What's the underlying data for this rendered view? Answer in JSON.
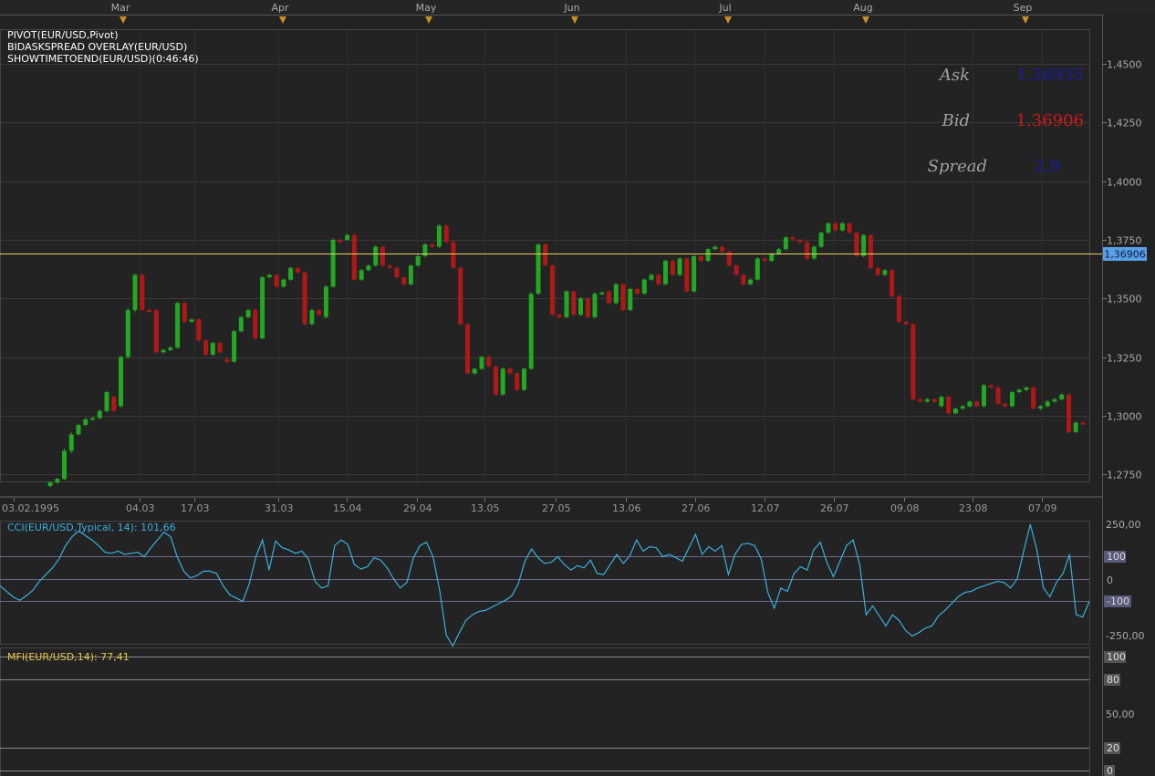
{
  "top_months": {
    "labels": [
      "Mar",
      "Apr",
      "May",
      "Jun",
      "Jul",
      "Aug",
      "Sep"
    ],
    "marker_color": "#c8902a"
  },
  "indicators": {
    "line1": "PIVOT(EUR/USD,Pivot)",
    "line2": "BIDASKSPREAD OVERLAY(EUR/USD)",
    "line3": "SHOWTIMETOEND(EUR/USD)(0:46:46)"
  },
  "quote": {
    "ask_label": "Ask",
    "ask_value": "1.36935",
    "bid_label": "Bid",
    "bid_value": "1.36906",
    "spread_label": "Spread",
    "spread_value": "2.9",
    "ask_color": "#1a1aa0",
    "bid_color": "#d01818",
    "label_color": "#a0a0a0"
  },
  "price_axis": {
    "ticks": [
      "1,4500",
      "1,4250",
      "1,4000",
      "1,3750",
      "1,3500",
      "1,3250",
      "1,3000",
      "1,2750"
    ],
    "current_label": "1,36906",
    "current_label_bg": "#5aa0e6"
  },
  "date_axis": {
    "labels": [
      "03.02.1995",
      "04.03",
      "17.03",
      "31.03",
      "15.04",
      "29.04",
      "13.05",
      "27.05",
      "13.06",
      "27.06",
      "12.07",
      "26.07",
      "09.08",
      "23.08",
      "07.09"
    ]
  },
  "cci": {
    "legend": "CCI(EUR/USD,Typical, 14): 101,66",
    "legend_color": "#3ab0e0",
    "axis_labels": {
      "top": "250,00",
      "p100": "100",
      "zero": "0",
      "m100": "-100",
      "bottom": "-250,00"
    }
  },
  "mfi": {
    "legend": "MFI(EUR/USD,14): 77,41",
    "legend_color": "#e8c848",
    "axis_labels": {
      "l100": "100",
      "l80": "80",
      "l50": "50,00",
      "l20": "20",
      "l0": "0"
    }
  },
  "colors": {
    "up": "#22a822",
    "down": "#b01818",
    "grid": "#3a3a3a",
    "pivot_line": "#e8d060",
    "cci_line": "#3ab0e0"
  },
  "chart_data": {
    "type": "candlestick",
    "title": "",
    "instrument": "EUR/USD",
    "pivot_level": 1.36906,
    "ylim": [
      1.2725,
      1.462
    ],
    "candles": [
      {
        "o": 1.27,
        "c": 1.2715,
        "h": 1.272,
        "l": 1.2695
      },
      {
        "o": 1.2715,
        "c": 1.273,
        "h": 1.2735,
        "l": 1.271
      },
      {
        "o": 1.273,
        "c": 1.285,
        "h": 1.286,
        "l": 1.2725
      },
      {
        "o": 1.285,
        "c": 1.292,
        "h": 1.293,
        "l": 1.284
      },
      {
        "o": 1.292,
        "c": 1.296,
        "h": 1.2965,
        "l": 1.2915
      },
      {
        "o": 1.296,
        "c": 1.2985,
        "h": 1.299,
        "l": 1.2955
      },
      {
        "o": 1.2985,
        "c": 1.299,
        "h": 1.2995,
        "l": 1.298
      },
      {
        "o": 1.299,
        "c": 1.302,
        "h": 1.3025,
        "l": 1.2985
      },
      {
        "o": 1.302,
        "c": 1.31,
        "h": 1.3105,
        "l": 1.3015
      },
      {
        "o": 1.308,
        "c": 1.302,
        "h": 1.3085,
        "l": 1.3015
      },
      {
        "o": 1.304,
        "c": 1.325,
        "h": 1.3255,
        "l": 1.3035
      },
      {
        "o": 1.325,
        "c": 1.345,
        "h": 1.346,
        "l": 1.3245
      },
      {
        "o": 1.345,
        "c": 1.36,
        "h": 1.3605,
        "l": 1.344
      },
      {
        "o": 1.36,
        "c": 1.345,
        "h": 1.3605,
        "l": 1.3445
      },
      {
        "o": 1.345,
        "c": 1.3445,
        "h": 1.3455,
        "l": 1.344
      },
      {
        "o": 1.345,
        "c": 1.327,
        "h": 1.3455,
        "l": 1.3265
      },
      {
        "o": 1.327,
        "c": 1.328,
        "h": 1.3285,
        "l": 1.3265
      },
      {
        "o": 1.328,
        "c": 1.329,
        "h": 1.3295,
        "l": 1.3275
      },
      {
        "o": 1.329,
        "c": 1.348,
        "h": 1.3485,
        "l": 1.3285
      },
      {
        "o": 1.348,
        "c": 1.34,
        "h": 1.3485,
        "l": 1.3395
      },
      {
        "o": 1.34,
        "c": 1.341,
        "h": 1.3415,
        "l": 1.3395
      },
      {
        "o": 1.341,
        "c": 1.332,
        "h": 1.3415,
        "l": 1.3315
      },
      {
        "o": 1.332,
        "c": 1.326,
        "h": 1.3325,
        "l": 1.3255
      },
      {
        "o": 1.326,
        "c": 1.331,
        "h": 1.3315,
        "l": 1.3255
      },
      {
        "o": 1.331,
        "c": 1.327,
        "h": 1.3315,
        "l": 1.3265
      },
      {
        "o": 1.324,
        "c": 1.323,
        "h": 1.325,
        "l": 1.3225
      },
      {
        "o": 1.323,
        "c": 1.336,
        "h": 1.3365,
        "l": 1.3225
      },
      {
        "o": 1.336,
        "c": 1.342,
        "h": 1.3425,
        "l": 1.3355
      },
      {
        "o": 1.342,
        "c": 1.345,
        "h": 1.3455,
        "l": 1.3415
      },
      {
        "o": 1.345,
        "c": 1.333,
        "h": 1.3455,
        "l": 1.3325
      },
      {
        "o": 1.333,
        "c": 1.359,
        "h": 1.3595,
        "l": 1.3325
      },
      {
        "o": 1.359,
        "c": 1.36,
        "h": 1.3605,
        "l": 1.3585
      },
      {
        "o": 1.36,
        "c": 1.355,
        "h": 1.3605,
        "l": 1.3545
      },
      {
        "o": 1.355,
        "c": 1.358,
        "h": 1.3585,
        "l": 1.3545
      },
      {
        "o": 1.358,
        "c": 1.363,
        "h": 1.3635,
        "l": 1.3575
      },
      {
        "o": 1.363,
        "c": 1.361,
        "h": 1.3635,
        "l": 1.3605
      },
      {
        "o": 1.361,
        "c": 1.339,
        "h": 1.3615,
        "l": 1.3385
      },
      {
        "o": 1.339,
        "c": 1.345,
        "h": 1.3455,
        "l": 1.3385
      },
      {
        "o": 1.345,
        "c": 1.343,
        "h": 1.3455,
        "l": 1.3425
      },
      {
        "o": 1.342,
        "c": 1.355,
        "h": 1.3555,
        "l": 1.3415
      },
      {
        "o": 1.355,
        "c": 1.375,
        "h": 1.3755,
        "l": 1.3545
      },
      {
        "o": 1.375,
        "c": 1.374,
        "h": 1.3755,
        "l": 1.3735
      },
      {
        "o": 1.375,
        "c": 1.377,
        "h": 1.3775,
        "l": 1.3745
      },
      {
        "o": 1.377,
        "c": 1.358,
        "h": 1.3775,
        "l": 1.3575
      },
      {
        "o": 1.358,
        "c": 1.362,
        "h": 1.3625,
        "l": 1.3575
      },
      {
        "o": 1.362,
        "c": 1.364,
        "h": 1.3645,
        "l": 1.3615
      },
      {
        "o": 1.364,
        "c": 1.372,
        "h": 1.3725,
        "l": 1.3635
      },
      {
        "o": 1.372,
        "c": 1.364,
        "h": 1.3725,
        "l": 1.3635
      },
      {
        "o": 1.364,
        "c": 1.363,
        "h": 1.3645,
        "l": 1.3625
      },
      {
        "o": 1.363,
        "c": 1.359,
        "h": 1.3635,
        "l": 1.3585
      },
      {
        "o": 1.359,
        "c": 1.356,
        "h": 1.3595,
        "l": 1.3555
      },
      {
        "o": 1.356,
        "c": 1.364,
        "h": 1.3645,
        "l": 1.3555
      },
      {
        "o": 1.364,
        "c": 1.368,
        "h": 1.3685,
        "l": 1.3635
      },
      {
        "o": 1.368,
        "c": 1.373,
        "h": 1.3735,
        "l": 1.3675
      },
      {
        "o": 1.373,
        "c": 1.372,
        "h": 1.3735,
        "l": 1.3715
      },
      {
        "o": 1.372,
        "c": 1.381,
        "h": 1.3815,
        "l": 1.3715
      },
      {
        "o": 1.381,
        "c": 1.374,
        "h": 1.3815,
        "l": 1.3735
      },
      {
        "o": 1.374,
        "c": 1.363,
        "h": 1.3745,
        "l": 1.3625
      },
      {
        "o": 1.363,
        "c": 1.339,
        "h": 1.3635,
        "l": 1.3385
      },
      {
        "o": 1.339,
        "c": 1.318,
        "h": 1.3395,
        "l": 1.3175
      },
      {
        "o": 1.318,
        "c": 1.32,
        "h": 1.3205,
        "l": 1.3175
      },
      {
        "o": 1.32,
        "c": 1.325,
        "h": 1.3255,
        "l": 1.3195
      },
      {
        "o": 1.325,
        "c": 1.321,
        "h": 1.3255,
        "l": 1.3205
      },
      {
        "o": 1.321,
        "c": 1.309,
        "h": 1.3215,
        "l": 1.3085
      },
      {
        "o": 1.309,
        "c": 1.32,
        "h": 1.3205,
        "l": 1.3085
      },
      {
        "o": 1.32,
        "c": 1.318,
        "h": 1.3205,
        "l": 1.3175
      },
      {
        "o": 1.318,
        "c": 1.311,
        "h": 1.3185,
        "l": 1.3105
      },
      {
        "o": 1.311,
        "c": 1.32,
        "h": 1.3205,
        "l": 1.3105
      },
      {
        "o": 1.32,
        "c": 1.352,
        "h": 1.3525,
        "l": 1.3195
      },
      {
        "o": 1.352,
        "c": 1.373,
        "h": 1.3735,
        "l": 1.3515
      },
      {
        "o": 1.373,
        "c": 1.364,
        "h": 1.3735,
        "l": 1.3635
      },
      {
        "o": 1.364,
        "c": 1.343,
        "h": 1.3645,
        "l": 1.3425
      },
      {
        "o": 1.343,
        "c": 1.342,
        "h": 1.3435,
        "l": 1.3415
      },
      {
        "o": 1.342,
        "c": 1.353,
        "h": 1.3535,
        "l": 1.3415
      },
      {
        "o": 1.353,
        "c": 1.343,
        "h": 1.3535,
        "l": 1.3425
      },
      {
        "o": 1.343,
        "c": 1.35,
        "h": 1.3505,
        "l": 1.3425
      },
      {
        "o": 1.35,
        "c": 1.342,
        "h": 1.3505,
        "l": 1.3415
      },
      {
        "o": 1.342,
        "c": 1.352,
        "h": 1.3525,
        "l": 1.3415
      },
      {
        "o": 1.352,
        "c": 1.3525,
        "h": 1.353,
        "l": 1.3515
      },
      {
        "o": 1.353,
        "c": 1.348,
        "h": 1.3535,
        "l": 1.3475
      },
      {
        "o": 1.348,
        "c": 1.356,
        "h": 1.3565,
        "l": 1.3475
      },
      {
        "o": 1.356,
        "c": 1.345,
        "h": 1.3565,
        "l": 1.3445
      },
      {
        "o": 1.345,
        "c": 1.354,
        "h": 1.3545,
        "l": 1.3445
      },
      {
        "o": 1.354,
        "c": 1.352,
        "h": 1.3545,
        "l": 1.3515
      },
      {
        "o": 1.352,
        "c": 1.358,
        "h": 1.3585,
        "l": 1.3515
      },
      {
        "o": 1.358,
        "c": 1.36,
        "h": 1.3605,
        "l": 1.3575
      },
      {
        "o": 1.36,
        "c": 1.356,
        "h": 1.3605,
        "l": 1.3555
      },
      {
        "o": 1.356,
        "c": 1.366,
        "h": 1.3665,
        "l": 1.3555
      },
      {
        "o": 1.366,
        "c": 1.36,
        "h": 1.3665,
        "l": 1.3595
      },
      {
        "o": 1.36,
        "c": 1.367,
        "h": 1.3675,
        "l": 1.3595
      },
      {
        "o": 1.367,
        "c": 1.353,
        "h": 1.3675,
        "l": 1.3525
      },
      {
        "o": 1.353,
        "c": 1.368,
        "h": 1.3685,
        "l": 1.3525
      },
      {
        "o": 1.368,
        "c": 1.366,
        "h": 1.3685,
        "l": 1.3655
      },
      {
        "o": 1.366,
        "c": 1.371,
        "h": 1.3715,
        "l": 1.3655
      },
      {
        "o": 1.371,
        "c": 1.372,
        "h": 1.3725,
        "l": 1.3705
      },
      {
        "o": 1.372,
        "c": 1.37,
        "h": 1.3725,
        "l": 1.3695
      },
      {
        "o": 1.37,
        "c": 1.364,
        "h": 1.3705,
        "l": 1.3635
      },
      {
        "o": 1.364,
        "c": 1.36,
        "h": 1.3645,
        "l": 1.3595
      },
      {
        "o": 1.36,
        "c": 1.356,
        "h": 1.3605,
        "l": 1.3555
      },
      {
        "o": 1.356,
        "c": 1.358,
        "h": 1.3585,
        "l": 1.3555
      },
      {
        "o": 1.358,
        "c": 1.367,
        "h": 1.3675,
        "l": 1.3575
      },
      {
        "o": 1.367,
        "c": 1.366,
        "h": 1.3675,
        "l": 1.3655
      },
      {
        "o": 1.366,
        "c": 1.369,
        "h": 1.3695,
        "l": 1.3655
      },
      {
        "o": 1.369,
        "c": 1.371,
        "h": 1.3715,
        "l": 1.3685
      },
      {
        "o": 1.371,
        "c": 1.376,
        "h": 1.3765,
        "l": 1.3705
      },
      {
        "o": 1.376,
        "c": 1.3755,
        "h": 1.3765,
        "l": 1.375
      },
      {
        "o": 1.375,
        "c": 1.374,
        "h": 1.3755,
        "l": 1.3735
      },
      {
        "o": 1.374,
        "c": 1.367,
        "h": 1.3745,
        "l": 1.3665
      },
      {
        "o": 1.367,
        "c": 1.372,
        "h": 1.3725,
        "l": 1.3665
      },
      {
        "o": 1.372,
        "c": 1.378,
        "h": 1.3785,
        "l": 1.3715
      },
      {
        "o": 1.378,
        "c": 1.382,
        "h": 1.3825,
        "l": 1.3775
      },
      {
        "o": 1.382,
        "c": 1.379,
        "h": 1.3825,
        "l": 1.3785
      },
      {
        "o": 1.379,
        "c": 1.382,
        "h": 1.3825,
        "l": 1.3785
      },
      {
        "o": 1.382,
        "c": 1.378,
        "h": 1.3825,
        "l": 1.3775
      },
      {
        "o": 1.378,
        "c": 1.368,
        "h": 1.3785,
        "l": 1.3675
      },
      {
        "o": 1.368,
        "c": 1.377,
        "h": 1.3775,
        "l": 1.3675
      },
      {
        "o": 1.377,
        "c": 1.363,
        "h": 1.3775,
        "l": 1.3625
      },
      {
        "o": 1.363,
        "c": 1.36,
        "h": 1.3635,
        "l": 1.3595
      },
      {
        "o": 1.36,
        "c": 1.362,
        "h": 1.3625,
        "l": 1.3595
      },
      {
        "o": 1.362,
        "c": 1.351,
        "h": 1.3625,
        "l": 1.3505
      },
      {
        "o": 1.351,
        "c": 1.34,
        "h": 1.3515,
        "l": 1.3395
      },
      {
        "o": 1.34,
        "c": 1.339,
        "h": 1.3405,
        "l": 1.3385
      },
      {
        "o": 1.339,
        "c": 1.307,
        "h": 1.3395,
        "l": 1.3065
      },
      {
        "o": 1.307,
        "c": 1.306,
        "h": 1.3075,
        "l": 1.3055
      },
      {
        "o": 1.306,
        "c": 1.307,
        "h": 1.3075,
        "l": 1.3055
      },
      {
        "o": 1.307,
        "c": 1.306,
        "h": 1.3075,
        "l": 1.3055
      },
      {
        "o": 1.304,
        "c": 1.308,
        "h": 1.3085,
        "l": 1.3035
      },
      {
        "o": 1.308,
        "c": 1.301,
        "h": 1.3085,
        "l": 1.3005
      },
      {
        "o": 1.301,
        "c": 1.303,
        "h": 1.3035,
        "l": 1.3005
      },
      {
        "o": 1.303,
        "c": 1.304,
        "h": 1.3045,
        "l": 1.3025
      },
      {
        "o": 1.304,
        "c": 1.306,
        "h": 1.3065,
        "l": 1.3035
      },
      {
        "o": 1.306,
        "c": 1.304,
        "h": 1.3065,
        "l": 1.3035
      },
      {
        "o": 1.304,
        "c": 1.313,
        "h": 1.3135,
        "l": 1.3035
      },
      {
        "o": 1.313,
        "c": 1.312,
        "h": 1.3135,
        "l": 1.3115
      },
      {
        "o": 1.312,
        "c": 1.305,
        "h": 1.3125,
        "l": 1.3045
      },
      {
        "o": 1.305,
        "c": 1.304,
        "h": 1.3055,
        "l": 1.3035
      },
      {
        "o": 1.304,
        "c": 1.31,
        "h": 1.3105,
        "l": 1.3035
      },
      {
        "o": 1.31,
        "c": 1.311,
        "h": 1.3115,
        "l": 1.3095
      },
      {
        "o": 1.311,
        "c": 1.312,
        "h": 1.3125,
        "l": 1.3105
      },
      {
        "o": 1.312,
        "c": 1.303,
        "h": 1.3125,
        "l": 1.3025
      },
      {
        "o": 1.303,
        "c": 1.304,
        "h": 1.3045,
        "l": 1.3025
      },
      {
        "o": 1.304,
        "c": 1.306,
        "h": 1.3065,
        "l": 1.3035
      },
      {
        "o": 1.306,
        "c": 1.307,
        "h": 1.3075,
        "l": 1.3055
      },
      {
        "o": 1.307,
        "c": 1.309,
        "h": 1.3095,
        "l": 1.3065
      },
      {
        "o": 1.309,
        "c": 1.293,
        "h": 1.3095,
        "l": 1.2925
      },
      {
        "o": 1.293,
        "c": 1.297,
        "h": 1.2975,
        "l": 1.2925
      },
      {
        "o": 1.297,
        "c": 1.2965,
        "h": 1.2975,
        "l": 1.296
      }
    ],
    "cci": [
      -30,
      -55,
      -80,
      -95,
      -75,
      -50,
      -10,
      20,
      50,
      90,
      150,
      190,
      215,
      195,
      175,
      150,
      120,
      115,
      125,
      110,
      115,
      120,
      100,
      140,
      175,
      210,
      190,
      100,
      35,
      5,
      15,
      35,
      35,
      25,
      -30,
      -70,
      -85,
      -100,
      -20,
      100,
      175,
      40,
      170,
      140,
      130,
      115,
      125,
      90,
      -10,
      -40,
      -30,
      150,
      175,
      155,
      65,
      45,
      55,
      95,
      85,
      50,
      0,
      -40,
      -15,
      95,
      150,
      165,
      100,
      -50,
      -250,
      -300,
      -240,
      -185,
      -160,
      -145,
      -140,
      -125,
      -110,
      -95,
      -75,
      -20,
      80,
      135,
      95,
      70,
      75,
      100,
      65,
      40,
      60,
      50,
      85,
      25,
      20,
      65,
      110,
      70,
      105,
      175,
      125,
      145,
      140,
      100,
      110,
      95,
      80,
      140,
      200,
      110,
      145,
      125,
      150,
      20,
      110,
      155,
      160,
      150,
      90,
      -60,
      -130,
      -40,
      -55,
      25,
      55,
      40,
      130,
      165,
      75,
      10,
      80,
      150,
      175,
      65,
      -160,
      -120,
      -165,
      -210,
      -160,
      -185,
      -230,
      -255,
      -240,
      -220,
      -210,
      -165,
      -140,
      -110,
      -80,
      -60,
      -55,
      -40,
      -30,
      -20,
      -10,
      -15,
      -40,
      0,
      125,
      245,
      130,
      -40,
      -80,
      -15,
      25,
      110,
      -160,
      -170,
      -100
    ],
    "cci_last": 101.66,
    "mfi_last": 77.41
  }
}
